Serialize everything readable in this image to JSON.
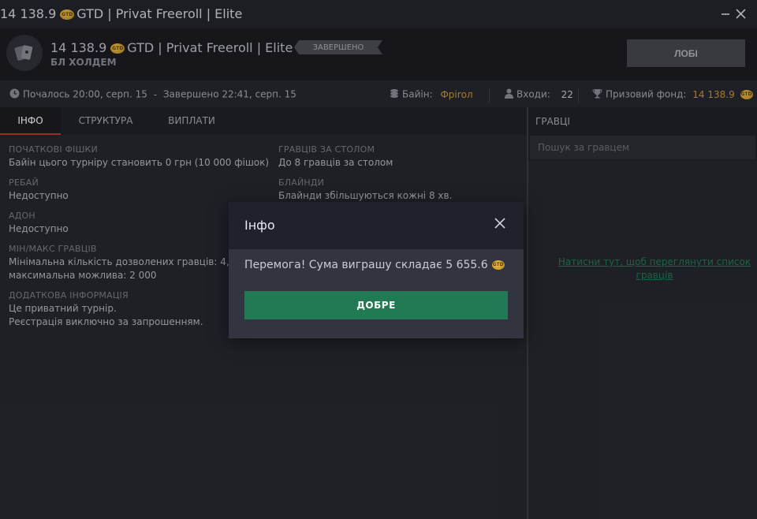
{
  "window": {
    "title_amount": "14 138.9",
    "title_rest": "GTD | Privat Freeroll | Elite",
    "coin_label": "GTD",
    "minimize_icon": "minimize-icon",
    "close_icon": "close-icon"
  },
  "header": {
    "tournament_amount": "14 138.9",
    "tournament_rest": "GTD | Privat Freeroll | Elite",
    "game_type": "БЛ ХОЛДЕМ",
    "status": "ЗАВЕРШЕНО",
    "lobby_button": "ЛОБІ"
  },
  "infobar": {
    "started": "Почалось 20:00, серп. 15",
    "dash": "-",
    "finished": "Завершено 22:41, серп. 15",
    "buyin_label": "Байін:",
    "buyin_value": "Фріrол",
    "entries_label": "Входи:",
    "entries_value": "22",
    "prize_label": "Призовий фонд:",
    "prize_value": "14 138.9"
  },
  "tabs": [
    {
      "label": "ІНФО",
      "active": true
    },
    {
      "label": "СТРУКТУРА",
      "active": false
    },
    {
      "label": "ВИПЛАТИ",
      "active": false
    }
  ],
  "info": {
    "starting_chips": {
      "label": "ПОЧАТКОВІ ФІШКИ",
      "value": "Байін цього турніру становить 0 грн (10 000 фішок)"
    },
    "rebuy": {
      "label": "РЕБАЙ",
      "value": "Недоступно"
    },
    "addon": {
      "label": "АДОН",
      "value": "Недоступно"
    },
    "min_max": {
      "label": "МІН/МАКС ГРАВЦІВ",
      "value_line1": "Мінімальна кількість дозволених гравців: 4,",
      "value_line2": "максимальна можлива: 2 000"
    },
    "extra": {
      "label": "ДОДАТКОВА ІНФОРМАЦІЯ",
      "value_line1": "Це приватний турнір.",
      "value_line2": "Реєстрація виключно за запрошенням."
    },
    "players_per_table": {
      "label": "ГРАВЦІВ ЗА СТОЛОМ",
      "value": "До 8 гравців за столом"
    },
    "blinds": {
      "label": "БЛАЙНДИ",
      "value": "Блайнди збільшуються кожні 8 хв."
    }
  },
  "players": {
    "header": "ГРАВЦІ",
    "search_placeholder": "Пошук за гравцем",
    "link_line1": "Натисни тут, щоб переглянути список",
    "link_line2": "гравців"
  },
  "modal": {
    "title": "Інфо",
    "message": "Перемога! Сума виграшу складає 5 655.6",
    "ok_button": "ДОБРЕ"
  },
  "colors": {
    "accent_green": "#217a53",
    "active_tab_underline": "#c0392b",
    "gold": "#c8973a"
  }
}
